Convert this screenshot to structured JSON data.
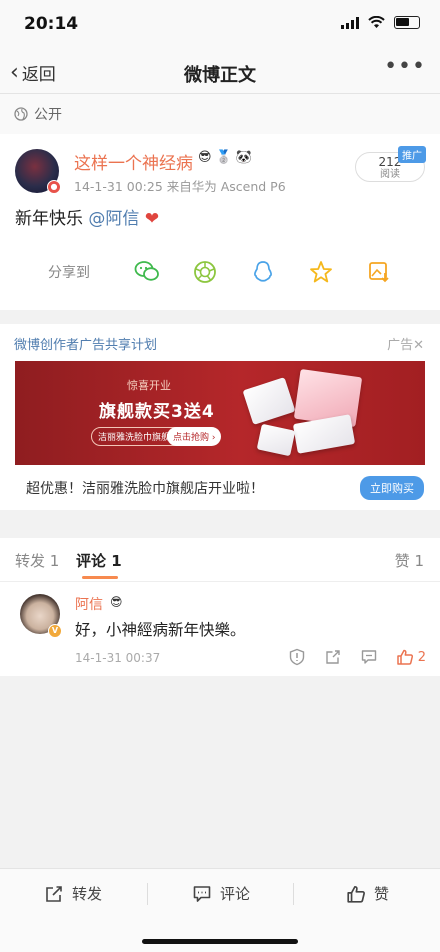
{
  "status": {
    "time": "20:14"
  },
  "nav": {
    "back_label": "返回",
    "title": "微博正文",
    "more": "•••"
  },
  "visibility": {
    "label": "公开"
  },
  "post": {
    "username": "这样一个神经病",
    "meta": "14-1-31 00:25   来自华为 Ascend P6",
    "read_count": "212",
    "read_label": "阅读",
    "promo_tag": "推广",
    "text": "新年快乐",
    "mention": "@阿信",
    "share_label": "分享到"
  },
  "ad": {
    "header": "微博创作者广告共享计划",
    "tag": "广告✕",
    "banner_subtitle": "惊喜开业",
    "banner_title": "旗舰款买3送4",
    "banner_store": "洁丽雅洗脸巾旗舰店",
    "banner_cta": "点击抢购 ›",
    "caption": "超优惠！洁丽雅洗脸巾旗舰店开业啦！",
    "buy_button": "立即购买"
  },
  "tabs": {
    "repost": "转发 1",
    "comment": "评论 1",
    "like": "赞 1"
  },
  "comment": {
    "username": "阿信",
    "text": "好，小神經病新年快樂。",
    "time": "14-1-31 00:37",
    "like_count": "2"
  },
  "bottom": {
    "repost": "转发",
    "comment": "评论",
    "like": "赞"
  },
  "colors": {
    "accent_orange": "#eb7350",
    "link_blue": "#507daf",
    "button_blue": "#4d9ae7",
    "ad_red": "#b5272a"
  }
}
